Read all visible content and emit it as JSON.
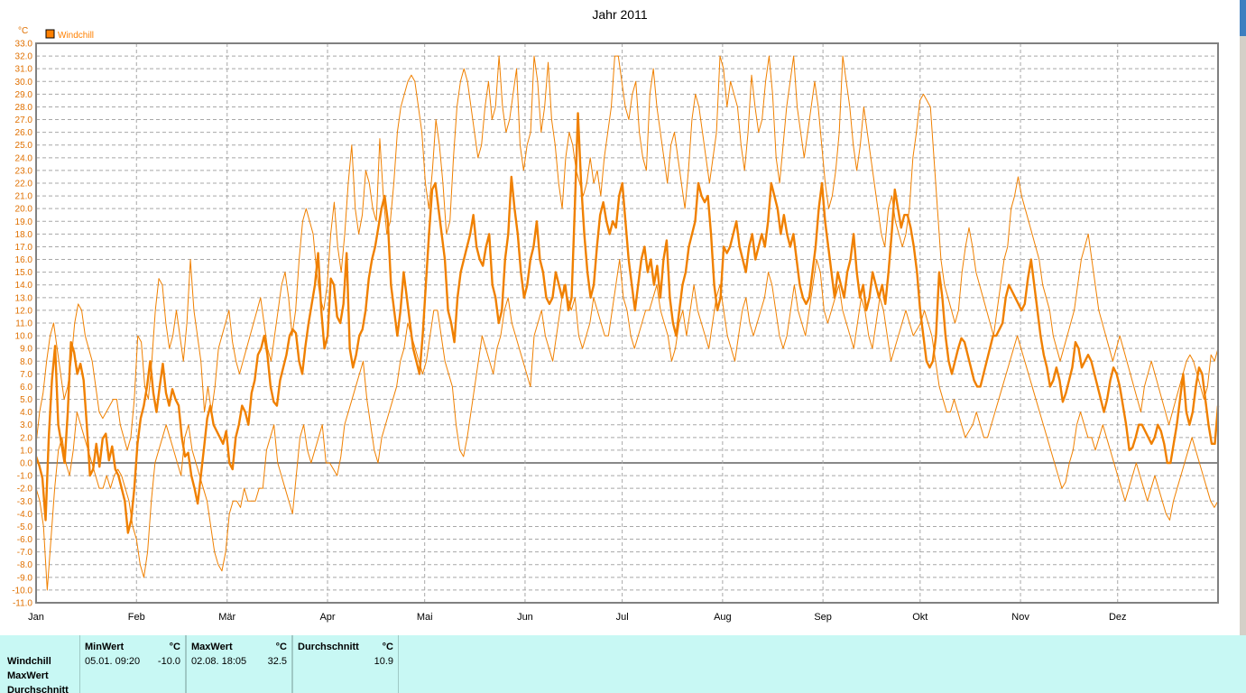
{
  "chart_data": {
    "type": "line",
    "title": "Jahr 2011",
    "unit_label": "°C",
    "legend": [
      {
        "name": "Windchill",
        "color": "#ff8000"
      }
    ],
    "legend_position": "top-left",
    "ylim": [
      -11,
      33
    ],
    "y_step": 1,
    "grid": true,
    "x_tick_labels": [
      "Jan",
      "Feb",
      "Mär",
      "Apr",
      "Mai",
      "Jun",
      "Jul",
      "Aug",
      "Sep",
      "Okt",
      "Nov",
      "Dez"
    ],
    "month_days": [
      31,
      28,
      31,
      30,
      31,
      30,
      31,
      31,
      30,
      31,
      30,
      31
    ],
    "series": [
      {
        "name": "Windchill",
        "role": "avg",
        "color": "#f08000",
        "values": [
          0.5,
          -0.2,
          -1.2,
          -4.5,
          2,
          6.5,
          9.2,
          3,
          1.5,
          0,
          4,
          9.5,
          8.7,
          7,
          7.8,
          6.5,
          3,
          -1,
          -0.5,
          1.5,
          -0.3,
          1.9,
          2.3,
          0.2,
          1.3,
          -0.5,
          -1,
          -2,
          -3,
          -5.5,
          -4.5,
          -2,
          1.5,
          3.5,
          4.5,
          6,
          8,
          5.5,
          4,
          6,
          7.8,
          5.5,
          4.5,
          5.8,
          5,
          4.5,
          2,
          0.5,
          0.8,
          -1,
          -2,
          -3.2,
          -1,
          1.2,
          3.5,
          4.5,
          3,
          2.5,
          2,
          1.5,
          2.5,
          0,
          -0.5,
          2,
          3,
          4.5,
          4,
          3,
          5.5,
          6.5,
          8.5,
          9,
          10,
          8.5,
          6,
          4.8,
          4.5,
          6.5,
          7.5,
          8.5,
          10,
          10.5,
          10.2,
          8,
          7,
          9.2,
          11,
          12.5,
          14,
          16.5,
          12,
          9,
          10,
          14.5,
          14,
          11.5,
          11,
          12.5,
          16.5,
          9,
          7.5,
          8.5,
          10,
          10.5,
          12,
          14.5,
          16,
          17,
          18.5,
          20,
          21,
          19,
          14,
          12,
          10,
          12,
          15,
          13,
          11,
          9,
          8,
          7,
          10,
          14,
          18,
          21.5,
          22,
          20,
          18,
          16,
          12,
          11,
          9.5,
          13,
          15,
          16,
          17,
          18,
          19.5,
          17,
          16,
          15.5,
          17,
          18,
          14,
          13,
          11,
          12,
          16,
          18,
          22.5,
          20,
          18,
          15,
          13,
          14,
          16,
          17,
          19,
          16,
          15,
          13,
          12.5,
          13,
          15,
          14,
          13,
          14,
          12,
          13,
          20,
          27.5,
          22,
          18,
          15,
          13,
          14,
          17,
          19.5,
          20.5,
          19,
          18,
          19,
          18.5,
          21,
          22,
          19,
          16,
          14,
          12,
          14,
          16,
          17,
          15,
          16,
          14,
          15.5,
          13,
          16,
          17.5,
          13,
          11,
          10,
          12,
          14,
          15,
          17,
          18,
          19,
          22,
          21,
          20.5,
          21,
          18,
          14,
          12,
          13,
          17,
          16.5,
          17,
          18,
          19,
          17,
          16,
          15,
          17,
          18,
          16,
          17,
          18,
          17,
          19,
          22,
          21,
          20,
          18,
          19.5,
          18,
          17,
          18,
          16,
          14,
          13,
          12.5,
          13,
          15,
          17,
          20,
          22,
          19,
          17,
          15,
          13,
          15,
          14,
          13,
          15,
          16,
          18,
          15,
          13,
          14,
          12,
          13,
          15,
          14,
          13,
          14,
          12.5,
          15,
          18,
          21.5,
          20,
          18.5,
          19.5,
          19.5,
          18.5,
          17,
          15,
          12,
          10,
          8,
          7.5,
          8,
          10,
          15,
          13,
          10,
          8,
          7,
          8,
          9,
          9.8,
          9.5,
          8.5,
          7.5,
          6.5,
          6,
          6,
          7,
          8,
          9,
          10,
          10,
          10.5,
          11,
          13,
          14,
          13.5,
          13,
          12.5,
          12,
          12.5,
          14.5,
          16,
          14,
          12,
          10,
          8.5,
          7.5,
          6,
          6.5,
          7.5,
          6.5,
          4.8,
          5.5,
          6.5,
          7.5,
          9.5,
          9,
          7.5,
          8,
          8.5,
          8,
          7,
          6,
          5,
          4,
          5,
          6.5,
          7.5,
          7,
          6,
          4.5,
          3,
          1,
          1.2,
          2,
          3,
          3,
          2.5,
          2,
          1.5,
          2,
          3,
          2.5,
          1.5,
          0,
          0,
          1.5,
          3,
          5,
          7,
          4,
          3,
          4,
          6,
          7.5,
          7,
          5,
          3,
          1.5,
          1.5,
          4.5
        ]
      },
      {
        "name": "Windchill",
        "role": "max",
        "color": "#f08000",
        "values": [
          1.5,
          4,
          5.5,
          8,
          10,
          11,
          9,
          7,
          5,
          6,
          8,
          11,
          12.5,
          12,
          10,
          9,
          8,
          6,
          4,
          3.5,
          4,
          4.5,
          5,
          5,
          3,
          2,
          1,
          2,
          5,
          10,
          9.5,
          6,
          5,
          8,
          12,
          14.5,
          14,
          11,
          9,
          10,
          12,
          10,
          8,
          11,
          16,
          12,
          10,
          8,
          4,
          6,
          4,
          6,
          9,
          10,
          11,
          12,
          9.5,
          8,
          7,
          8,
          9,
          10,
          11,
          12,
          13,
          11,
          9,
          8,
          10,
          12,
          14,
          15,
          13,
          10,
          12,
          16,
          19,
          20,
          19,
          18,
          15,
          13,
          12,
          14,
          18,
          20.5,
          17,
          15,
          18,
          22,
          25,
          20,
          18,
          19.5,
          23,
          22,
          20,
          19,
          25.5,
          21,
          18,
          19,
          22,
          26,
          28,
          29,
          30,
          30.5,
          30,
          28,
          26,
          22,
          20,
          23,
          27,
          25,
          22,
          18,
          19,
          24,
          28,
          30,
          31,
          30,
          28,
          26,
          24,
          25,
          28,
          30,
          27,
          28,
          32,
          28,
          26,
          27,
          29,
          31,
          25,
          23,
          25,
          26,
          32,
          30,
          26,
          28,
          31.5,
          27,
          25,
          22,
          20,
          24,
          26,
          25,
          23,
          22,
          21,
          22,
          24,
          22,
          23,
          21,
          24,
          26,
          28,
          32,
          32,
          30,
          28,
          27,
          29,
          30,
          26,
          24,
          23,
          29,
          31,
          28,
          26,
          24,
          22,
          25,
          26,
          24,
          22,
          20,
          23,
          27,
          29,
          28,
          26,
          24,
          22,
          24,
          26,
          32,
          31,
          28,
          30,
          29,
          28,
          25,
          23,
          26,
          30.5,
          28,
          26,
          27,
          30,
          32,
          29,
          24,
          22,
          25,
          28,
          30,
          32,
          28,
          26,
          24,
          26,
          28,
          30,
          28,
          25,
          22,
          20,
          21,
          23,
          26,
          32,
          30,
          28,
          25,
          23,
          25,
          28,
          26,
          24,
          22,
          20,
          18,
          17,
          20,
          21,
          19,
          18,
          17,
          18,
          20,
          24,
          26,
          28.5,
          29,
          28.5,
          28,
          24,
          20,
          16,
          14,
          13,
          12,
          11,
          12,
          15,
          17,
          18.5,
          17,
          15,
          14,
          13,
          12,
          11,
          10,
          12,
          14,
          16,
          17,
          20,
          21,
          22.5,
          21,
          20,
          19,
          18,
          17,
          16,
          14,
          13,
          12,
          10,
          9,
          8,
          9,
          10,
          11,
          12,
          14,
          16,
          17,
          18,
          16,
          14,
          12,
          11,
          10,
          9,
          8,
          9,
          10,
          9,
          8,
          7,
          6,
          5,
          4,
          6,
          7,
          8,
          7,
          6,
          5,
          4,
          3,
          4,
          5,
          6,
          7,
          8,
          8.5,
          8,
          7,
          6,
          5,
          6,
          8.5,
          8,
          9
        ]
      },
      {
        "name": "Windchill",
        "role": "min",
        "color": "#f08000",
        "values": [
          -2,
          -3,
          -5,
          -10,
          -6,
          -2,
          1,
          2,
          0,
          -1,
          1,
          4,
          3,
          2,
          1,
          0,
          -1,
          -2,
          -2,
          -1,
          -2,
          -1,
          -0.5,
          -1,
          -2,
          -3,
          -5,
          -6,
          -8,
          -9,
          -7,
          -3,
          0,
          1,
          2,
          3,
          2,
          1,
          0,
          -1,
          2,
          3,
          1,
          0,
          -1,
          -2,
          -3,
          -5,
          -7,
          -8,
          -8.5,
          -7,
          -4,
          -3,
          -3,
          -3.5,
          -2,
          -3,
          -3,
          -3,
          -2,
          -2,
          1,
          2,
          3,
          0,
          -1,
          -2,
          -3,
          -4,
          -1,
          2,
          3,
          1,
          0,
          1,
          2,
          3,
          0,
          0,
          -0.5,
          -1,
          0.5,
          3,
          4,
          5,
          6,
          7,
          8,
          5,
          3,
          1,
          0,
          2,
          3,
          4,
          5,
          6,
          8,
          9,
          11,
          10,
          9,
          8,
          7,
          8,
          10,
          12,
          12,
          10,
          8,
          7,
          6,
          3,
          1,
          0.5,
          2,
          4,
          6,
          8,
          10,
          9,
          8,
          7,
          9,
          10,
          12,
          13,
          11,
          10,
          9,
          8,
          7,
          6,
          10,
          11,
          12,
          10,
          9,
          8,
          10,
          12,
          14,
          13,
          12,
          13,
          10,
          9,
          10,
          11,
          13,
          12,
          11,
          10,
          10,
          12,
          14,
          16,
          13,
          12,
          10,
          9,
          10,
          11,
          12,
          12,
          13,
          14,
          12,
          11,
          10,
          8,
          9,
          11,
          12,
          10,
          12,
          14,
          12,
          11,
          10,
          9,
          11,
          13,
          14,
          12,
          10,
          9,
          8,
          10,
          12,
          13,
          11,
          10,
          11,
          12,
          13,
          15,
          14,
          12,
          10,
          9,
          10,
          12,
          14,
          12,
          11,
          10,
          12,
          14,
          16,
          15,
          12,
          11,
          12,
          13,
          14,
          12,
          11,
          10,
          9,
          11,
          13,
          12,
          10,
          9,
          11,
          13,
          12,
          10,
          8,
          9,
          10,
          11,
          12,
          11,
          10,
          10.5,
          11,
          12,
          11,
          10,
          8,
          6,
          5,
          4,
          4,
          5,
          4,
          3,
          2,
          2.5,
          3,
          4,
          3,
          2,
          2,
          3,
          4,
          5,
          6,
          7,
          8,
          9,
          10,
          9,
          8,
          7,
          6,
          5,
          4,
          3,
          2,
          1,
          0,
          -1,
          -2,
          -1.5,
          0,
          1,
          3,
          4,
          3,
          2,
          2,
          1,
          2,
          3,
          2,
          1,
          0,
          -1,
          -2,
          -3,
          -2,
          -1,
          0,
          -1,
          -2,
          -3,
          -2,
          -1,
          -2,
          -3,
          -4,
          -4.5,
          -3,
          -2,
          -1,
          0,
          1,
          2,
          1,
          0,
          -1,
          -2,
          -3,
          -3.5,
          -3
        ]
      }
    ]
  },
  "stats": {
    "row_labels": [
      "Windchill",
      "MaxWert",
      "Durchschnitt"
    ],
    "columns": [
      {
        "header": "MinWert",
        "unit": "°C",
        "date": "05.01.  09:20",
        "value": "-10.0"
      },
      {
        "header": "MaxWert",
        "unit": "°C",
        "date": "02.08.  18:05",
        "value": "32.5"
      },
      {
        "header": "Durchschnitt",
        "unit": "°C",
        "date": "",
        "value": "10.9"
      }
    ]
  }
}
